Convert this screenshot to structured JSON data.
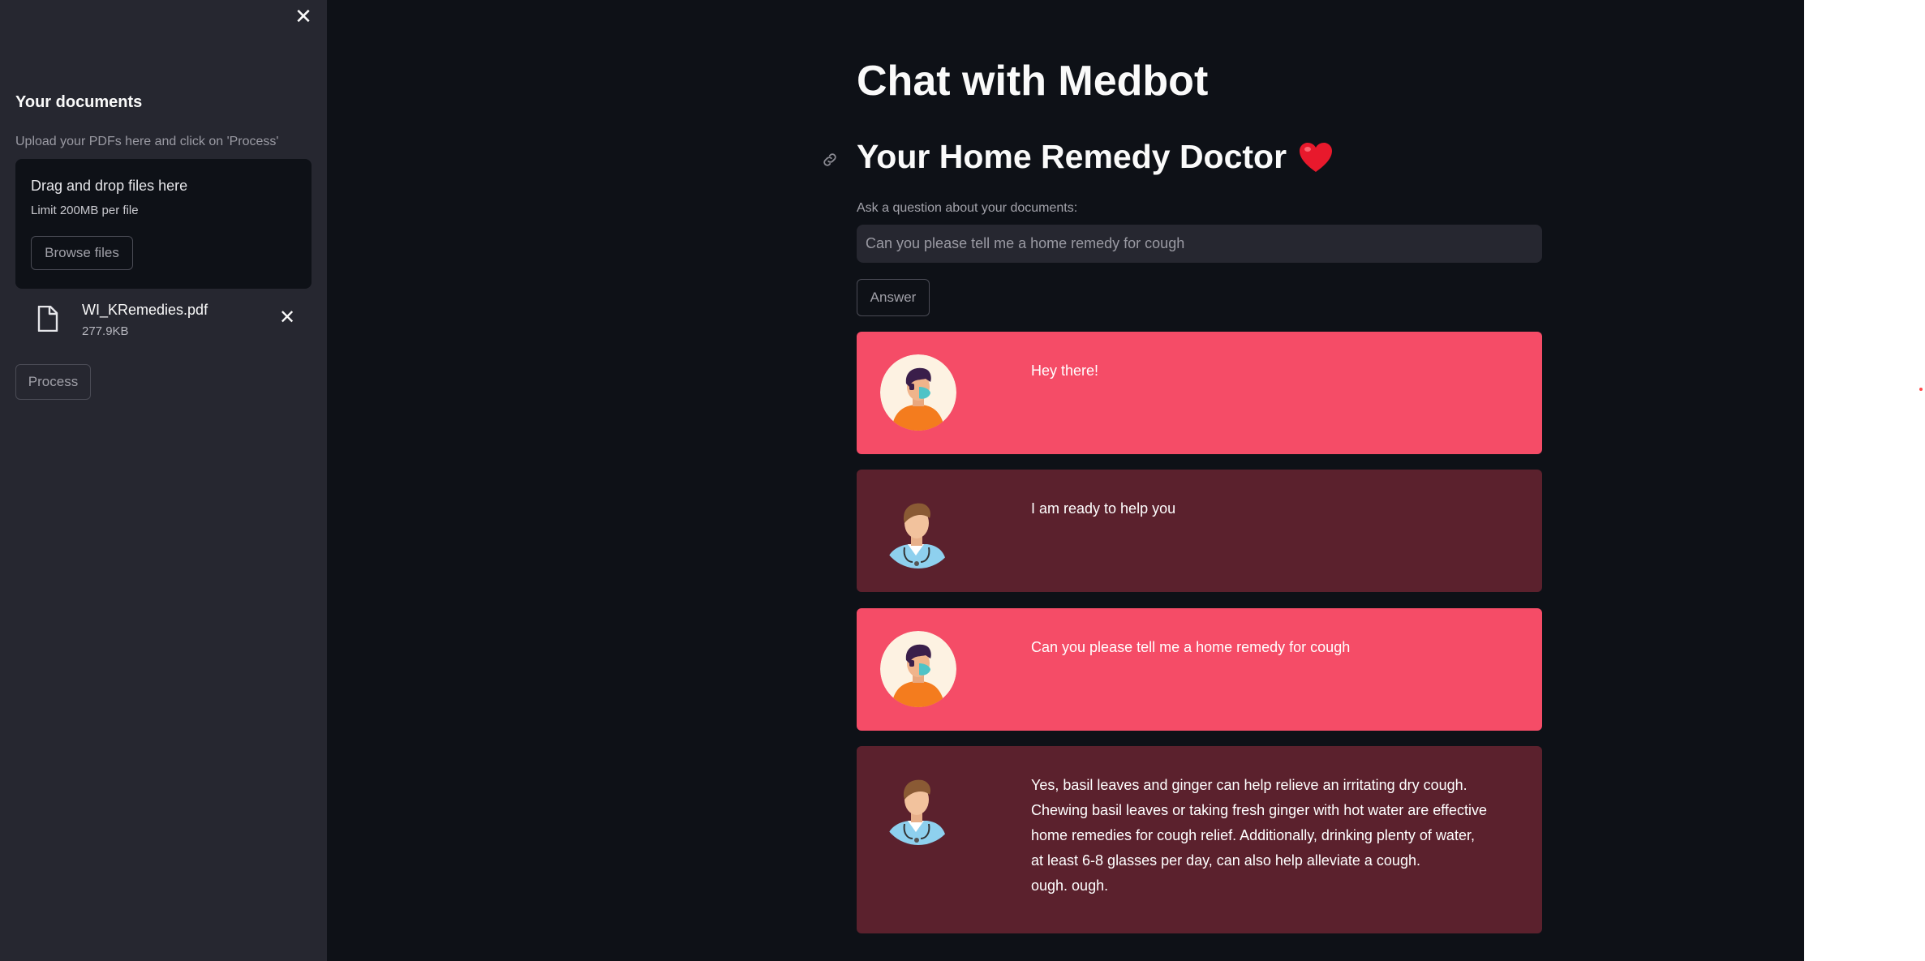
{
  "sidebar": {
    "title": "Your documents",
    "upload_label": "Upload your PDFs here and click on 'Process'",
    "dropzone": {
      "title": "Drag and drop files here",
      "limit": "Limit 200MB per file",
      "browse_label": "Browse files"
    },
    "file": {
      "name": "WI_KRemedies.pdf",
      "size": "277.9KB"
    },
    "process_label": "Process"
  },
  "main": {
    "title": "Chat with Medbot",
    "subtitle": "Your Home Remedy Doctor",
    "question_label": "Ask a question about your documents:",
    "question_placeholder": "Can you please tell me a home remedy for cough",
    "answer_label": "Answer"
  },
  "chat": [
    {
      "role": "user",
      "text": "Hey there!"
    },
    {
      "role": "bot",
      "text": "I am ready to help you"
    },
    {
      "role": "user",
      "text": "Can you please tell me a home remedy for cough"
    },
    {
      "role": "bot",
      "lines": [
        "Yes, basil leaves and ginger can help relieve an irritating dry cough.",
        "Chewing basil leaves or taking fresh ginger with hot water are effective",
        "home remedies for cough relief. Additionally, drinking plenty of water,",
        "at least 6-8 glasses per day, can also help alleviate a cough.",
        "ough. ough."
      ]
    }
  ],
  "colors": {
    "user_bubble": "#f54c67",
    "bot_bubble": "#5b212d",
    "sidebar_bg": "#262730",
    "main_bg": "#0e1117"
  }
}
